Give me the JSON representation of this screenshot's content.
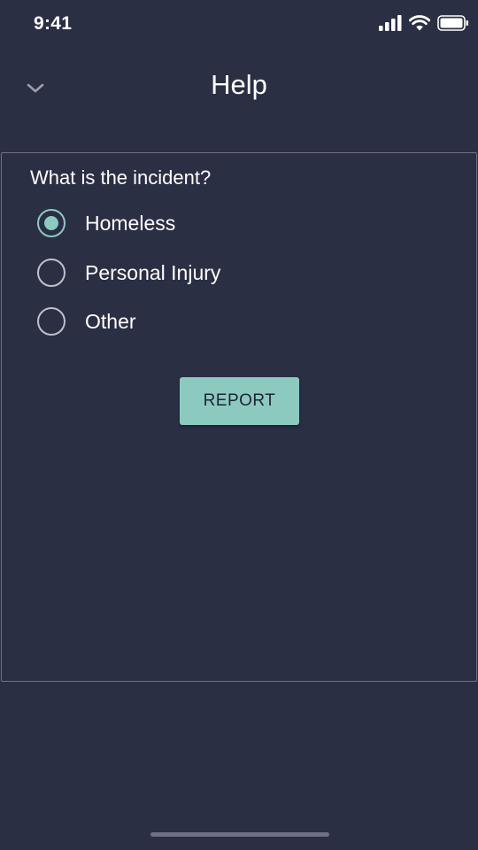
{
  "status_bar": {
    "time": "9:41",
    "icons": [
      "signal-icon",
      "wifi-icon",
      "battery-icon"
    ]
  },
  "header": {
    "back_icon": "chevron-down-icon",
    "title": "Help"
  },
  "form": {
    "question": "What is the incident?",
    "options": [
      {
        "label": "Homeless",
        "selected": true
      },
      {
        "label": "Personal Injury",
        "selected": false
      },
      {
        "label": "Other",
        "selected": false
      }
    ],
    "submit_label": "REPORT"
  },
  "colors": {
    "background": "#2b2f43",
    "accent": "#8ccac0",
    "card_border": "#6f7283",
    "radio_unselected": "#bfc1c9"
  }
}
